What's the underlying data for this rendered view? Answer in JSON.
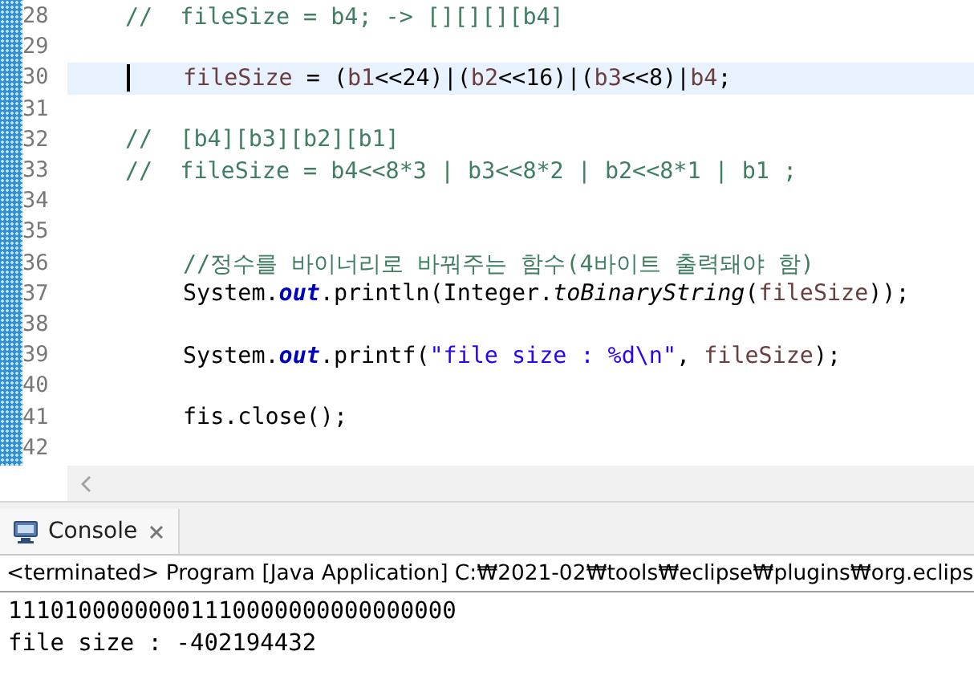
{
  "editor": {
    "lines": [
      {
        "number": "28",
        "kind": "shallow",
        "current": false,
        "segments": [
          {
            "kind": "comment",
            "text": "//  fileSize = b4; -> [][][][b4]"
          }
        ]
      },
      {
        "number": "29",
        "kind": "blank",
        "current": false
      },
      {
        "number": "30",
        "kind": "deep",
        "current": true,
        "segments": [
          {
            "kind": "variable",
            "text": "fileSize"
          },
          {
            "kind": "plain",
            "text": " = ("
          },
          {
            "kind": "variable",
            "text": "b1"
          },
          {
            "kind": "plain",
            "text": "<<24)|("
          },
          {
            "kind": "variable",
            "text": "b2"
          },
          {
            "kind": "plain",
            "text": "<<16)|("
          },
          {
            "kind": "variable",
            "text": "b3"
          },
          {
            "kind": "plain",
            "text": "<<8)|"
          },
          {
            "kind": "variable",
            "text": "b4"
          },
          {
            "kind": "plain",
            "text": ";"
          }
        ]
      },
      {
        "number": "31",
        "kind": "blank",
        "current": false
      },
      {
        "number": "32",
        "kind": "shallow",
        "current": false,
        "segments": [
          {
            "kind": "comment",
            "text": "//  [b4][b3][b2][b1]"
          }
        ]
      },
      {
        "number": "33",
        "kind": "shallow",
        "current": false,
        "segments": [
          {
            "kind": "comment",
            "text": "//  fileSize = b4<<8*3 | b3<<8*2 | b2<<8*1 | b1 ;"
          }
        ]
      },
      {
        "number": "34",
        "kind": "blank",
        "current": false
      },
      {
        "number": "35",
        "kind": "blank",
        "current": false
      },
      {
        "number": "36",
        "kind": "deep",
        "current": false,
        "segments": [
          {
            "kind": "comment",
            "text": "//정수를 바이너리로 바꿔주는 함수(4바이트 출력돼야 함)"
          }
        ]
      },
      {
        "number": "37",
        "kind": "deep",
        "current": false,
        "segments": [
          {
            "kind": "plain",
            "text": "System."
          },
          {
            "kind": "field",
            "text": "out"
          },
          {
            "kind": "plain",
            "text": ".println(Integer."
          },
          {
            "kind": "static",
            "text": "toBinaryString"
          },
          {
            "kind": "plain",
            "text": "("
          },
          {
            "kind": "variable",
            "text": "fileSize"
          },
          {
            "kind": "plain",
            "text": "));"
          }
        ]
      },
      {
        "number": "38",
        "kind": "blank",
        "current": false
      },
      {
        "number": "39",
        "kind": "deep",
        "current": false,
        "segments": [
          {
            "kind": "plain",
            "text": "System."
          },
          {
            "kind": "field",
            "text": "out"
          },
          {
            "kind": "plain",
            "text": ".printf("
          },
          {
            "kind": "string",
            "text": "\"file size : %d\\n\""
          },
          {
            "kind": "plain",
            "text": ", "
          },
          {
            "kind": "variable",
            "text": "fileSize"
          },
          {
            "kind": "plain",
            "text": ");"
          }
        ]
      },
      {
        "number": "40",
        "kind": "blank",
        "current": false
      },
      {
        "number": "41",
        "kind": "deep",
        "current": false,
        "segments": [
          {
            "kind": "plain",
            "text": "fis.close();"
          }
        ]
      },
      {
        "number": "42",
        "kind": "blank",
        "current": false
      }
    ]
  },
  "console": {
    "tab": {
      "label": "Console",
      "selected": true
    },
    "header": "<terminated> Program [Java Application] C:₩2021-02₩tools₩eclipse₩plugins₩org.eclips",
    "output": [
      "11101000000001110000000000000000",
      "file size : -402194432"
    ]
  }
}
